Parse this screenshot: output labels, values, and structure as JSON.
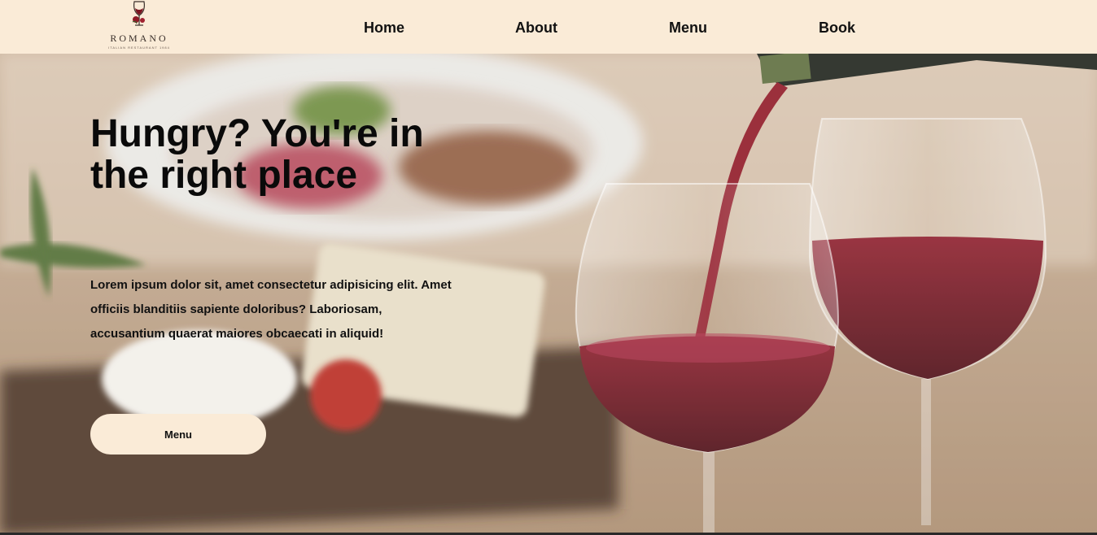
{
  "brand": {
    "name": "ROMANO",
    "tagline": "ITALIAN RESTAURANT 1984"
  },
  "nav": {
    "home": "Home",
    "about": "About",
    "menu": "Menu",
    "book": "Book"
  },
  "hero": {
    "title": "Hungry? You're in the right place",
    "description": "Lorem ipsum dolor sit, amet consectetur adipisicing elit. Amet officiis blanditiis sapiente doloribus? Laboriosam, accusantium quaerat maiores obcaecati in aliquid!",
    "button_label": "Menu"
  },
  "colors": {
    "navbar_bg": "#faebd7",
    "button_bg": "#faebd7",
    "wine": "#6e0f1c"
  },
  "icons": {
    "logo": "wine-glass-with-rose-logo"
  }
}
